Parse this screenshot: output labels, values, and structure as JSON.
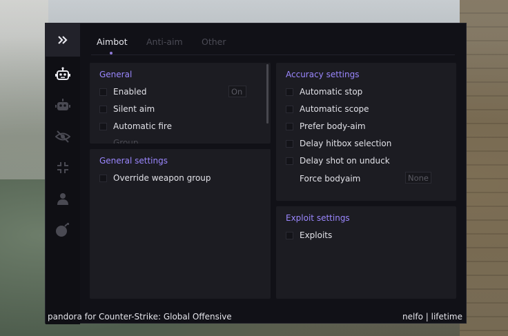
{
  "sidebar": {
    "collapse_icon": "double-chevron-right-icon",
    "items": [
      {
        "icon": "robot-icon",
        "active": true
      },
      {
        "icon": "robot-outline-icon",
        "active": false
      },
      {
        "icon": "eye-off-icon",
        "active": false
      },
      {
        "icon": "compress-icon",
        "active": false
      },
      {
        "icon": "user-icon",
        "active": false
      },
      {
        "icon": "bomb-icon",
        "active": false
      }
    ]
  },
  "tabs": [
    {
      "label": "Aimbot",
      "active": true
    },
    {
      "label": "Anti-aim",
      "active": false
    },
    {
      "label": "Other",
      "active": false
    }
  ],
  "general": {
    "title": "General",
    "items": [
      {
        "label": "Enabled",
        "checked": false
      },
      {
        "label": "Silent aim",
        "checked": false
      },
      {
        "label": "Automatic fire",
        "checked": false
      },
      {
        "label": "Group",
        "checked": false
      }
    ],
    "keybind_value": "On"
  },
  "general_settings": {
    "title": "General settings",
    "items": [
      {
        "label": "Override weapon group",
        "checked": false
      }
    ]
  },
  "accuracy": {
    "title": "Accuracy settings",
    "items": [
      {
        "label": "Automatic stop",
        "checked": false
      },
      {
        "label": "Automatic scope",
        "checked": false
      },
      {
        "label": "Prefer body-aim",
        "checked": false
      },
      {
        "label": "Delay hitbox selection",
        "checked": false
      },
      {
        "label": "Delay shot on unduck",
        "checked": false
      }
    ],
    "force_bodyaim_label": "Force bodyaim",
    "force_bodyaim_value": "None"
  },
  "exploit": {
    "title": "Exploit settings",
    "items": [
      {
        "label": "Exploits",
        "checked": false
      }
    ]
  },
  "footer": {
    "left": "pandora for Counter-Strike: Global Offensive",
    "right": "nelfo | lifetime"
  },
  "colors": {
    "accent": "#9b87ff",
    "background": "#111117",
    "panel": "#1c1c22"
  }
}
